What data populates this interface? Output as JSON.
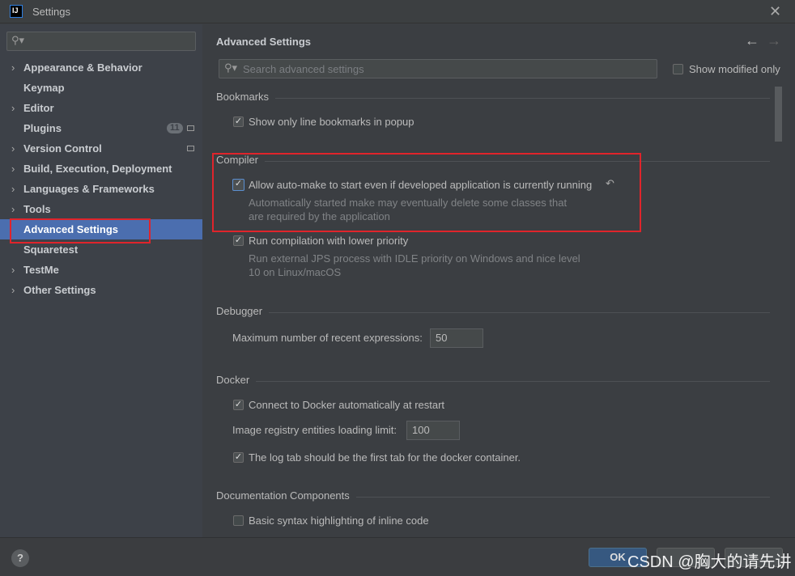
{
  "window": {
    "title": "Settings",
    "logo": "IJ",
    "close_icon": "close-icon"
  },
  "sidebar": {
    "search_icon": "search-icon",
    "items": [
      {
        "label": "Appearance & Behavior",
        "expandable": true
      },
      {
        "label": "Keymap",
        "expandable": false
      },
      {
        "label": "Editor",
        "expandable": true
      },
      {
        "label": "Plugins",
        "expandable": false,
        "badge": "11"
      },
      {
        "label": "Version Control",
        "expandable": true
      },
      {
        "label": "Build, Execution, Deployment",
        "expandable": true
      },
      {
        "label": "Languages & Frameworks",
        "expandable": true
      },
      {
        "label": "Tools",
        "expandable": true
      },
      {
        "label": "Advanced Settings",
        "expandable": false,
        "selected": true
      },
      {
        "label": "Squaretest",
        "expandable": false
      },
      {
        "label": "TestMe",
        "expandable": true
      },
      {
        "label": "Other Settings",
        "expandable": true
      }
    ]
  },
  "main": {
    "title": "Advanced Settings",
    "search_placeholder": "Search advanced settings",
    "show_modified_only": "Show modified only",
    "sections": {
      "bookmarks": {
        "title": "Bookmarks",
        "opt1": "Show only line bookmarks in popup"
      },
      "compiler": {
        "title": "Compiler",
        "opt1": "Allow auto-make to start even if developed application is currently running",
        "opt1_desc1": "Automatically started make may eventually delete some classes that",
        "opt1_desc2": "are required by the application",
        "opt2": "Run compilation with lower priority",
        "opt2_desc1": "Run external JPS process with IDLE priority on Windows and nice level",
        "opt2_desc2": "10 on Linux/macOS"
      },
      "debugger": {
        "title": "Debugger",
        "label": "Maximum number of recent expressions:",
        "value": "50"
      },
      "docker": {
        "title": "Docker",
        "opt1": "Connect to Docker automatically at restart",
        "label": "Image registry entities loading limit:",
        "value": "100",
        "opt2": "The log tab should be the first tab for the docker container."
      },
      "docs": {
        "title": "Documentation Components",
        "opt1": "Basic syntax highlighting of inline code"
      }
    }
  },
  "footer": {
    "help": "?",
    "ok": "OK"
  },
  "watermark": "CSDN @胸大的请先讲",
  "colors": {
    "accent": "#4b6eaf",
    "highlight": "#e0242b"
  }
}
